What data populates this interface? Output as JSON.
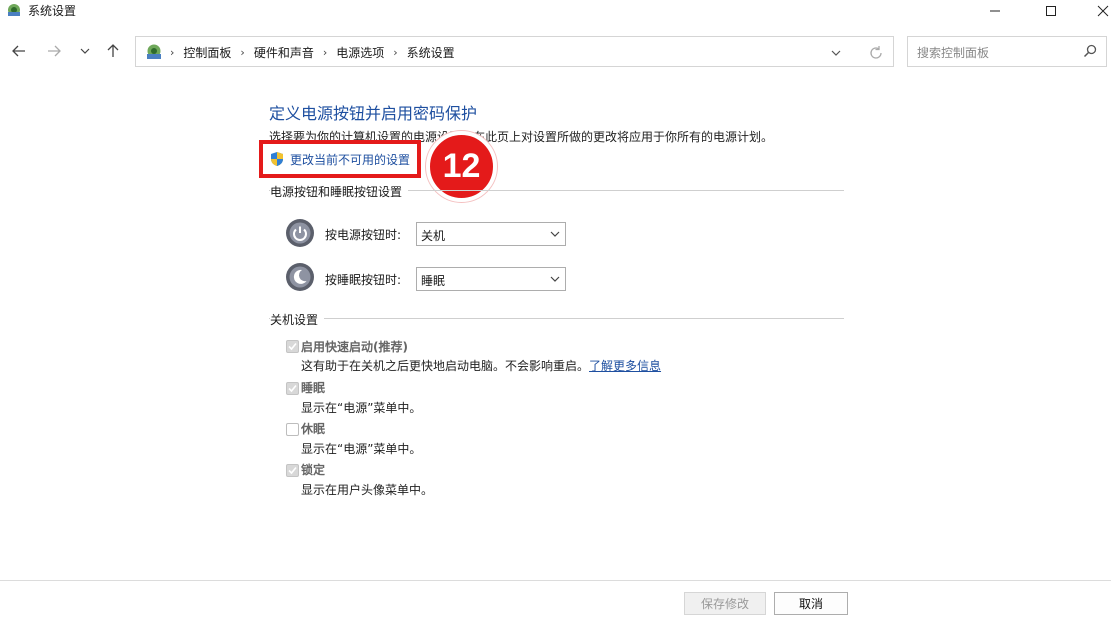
{
  "window": {
    "title": "系统设置"
  },
  "breadcrumb": {
    "items": [
      "控制面板",
      "硬件和声音",
      "电源选项",
      "系统设置"
    ]
  },
  "search": {
    "placeholder": "搜索控制面板"
  },
  "content": {
    "title": "定义电源按钮并启用密码保护",
    "description": "选择要为你的计算机设置的电源设置。在此页上对设置所做的更改将应用于你所有的电源计划。",
    "change_link": "更改当前不可用的设置",
    "step_badge": "12"
  },
  "power_buttons": {
    "group_label": "电源按钮和睡眠按钮设置",
    "power": {
      "label": "按电源按钮时:",
      "value": "关机"
    },
    "sleep": {
      "label": "按睡眠按钮时:",
      "value": "睡眠"
    }
  },
  "shutdown": {
    "group_label": "关机设置",
    "options": [
      {
        "title": "启用快速启动(推荐)",
        "desc": "这有助于在关机之后更快地启动电脑。不会影响重启。",
        "link": "了解更多信息",
        "checked": true
      },
      {
        "title": "睡眠",
        "desc": "显示在“电源”菜单中。",
        "checked": true
      },
      {
        "title": "休眠",
        "desc": "显示在“电源”菜单中。",
        "checked": false
      },
      {
        "title": "锁定",
        "desc": "显示在用户头像菜单中。",
        "checked": true
      }
    ]
  },
  "footer": {
    "save": "保存修改",
    "cancel": "取消"
  },
  "colors": {
    "accent": "#1e4fa0",
    "highlight": "#e41a1a"
  }
}
